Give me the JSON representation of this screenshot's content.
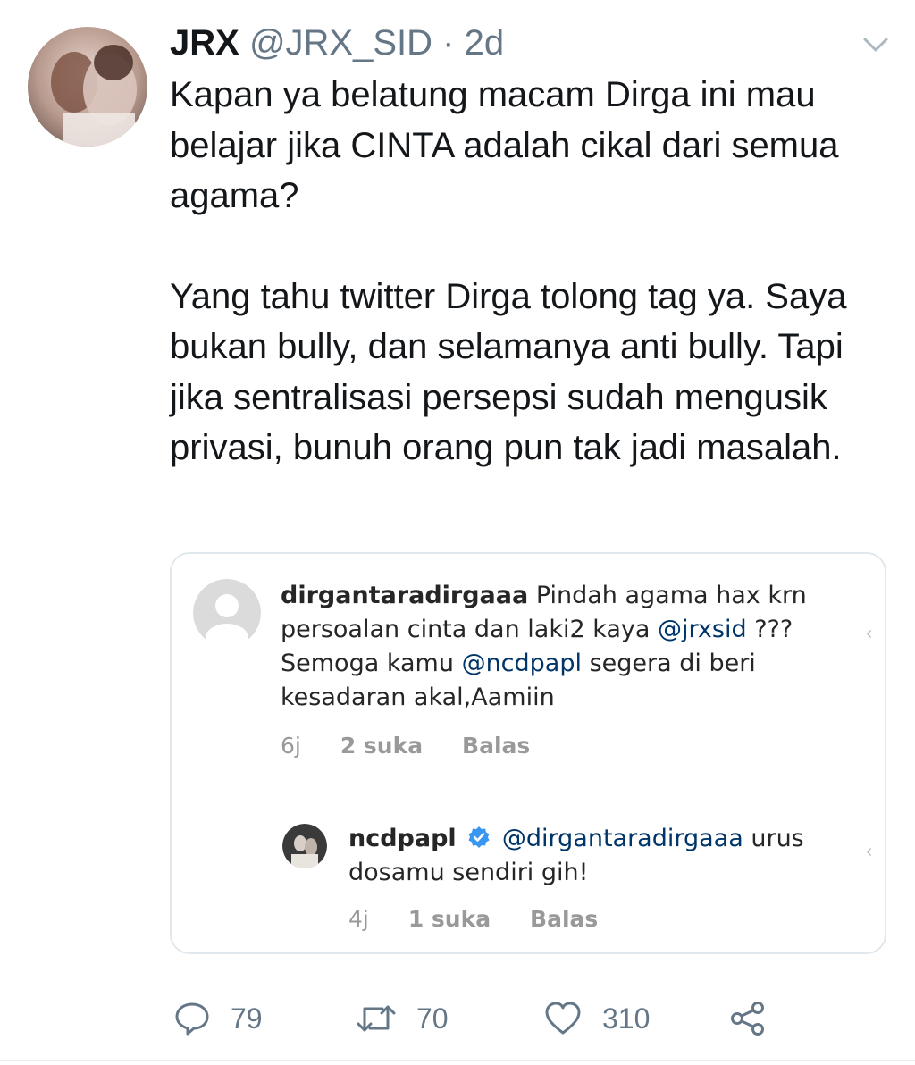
{
  "tweet": {
    "display_name": "JRX",
    "handle": "@JRX_SID",
    "separator": "·",
    "time": "2d",
    "text_p1": "Kapan ya belatung macam Dirga ini mau belajar jika CINTA adalah cikal dari semua agama?",
    "text_p2": "Yang tahu twitter Dirga tolong tag ya. Saya bukan bully, dan selamanya anti bully. Tapi jika sentralisasi persepsi sudah mengusik privasi, bunuh orang pun tak jadi masalah."
  },
  "embedded_screenshot": {
    "comment1": {
      "username": "dirgantaradirgaaa",
      "text_a": "Pindah agama hax krn persoalan cinta dan laki2 kaya",
      "mention1": "@jrxsid",
      "text_b": "??? Semoga kamu",
      "mention2": "@ncdpapl",
      "text_c": "segera di beri kesadaran akal,Aamiin",
      "age": "6j",
      "likes": "2 suka",
      "reply_label": "Balas"
    },
    "comment2": {
      "username": "ncdpapl",
      "mention": "@dirgantaradirgaaa",
      "text": "urus dosamu sendiri gih!",
      "age": "4j",
      "likes": "1 suka",
      "reply_label": "Balas"
    }
  },
  "actions": {
    "replies": "79",
    "retweets": "70",
    "likes": "310"
  },
  "icons": {
    "reply": "reply-icon",
    "retweet": "retweet-icon",
    "like": "heart-icon",
    "share": "share-icon",
    "menu": "chevron-down-icon",
    "verified": "verified-badge-icon"
  },
  "colors": {
    "text": "#14171a",
    "secondary": "#657786",
    "instagram_link": "#003569",
    "verified": "#3897f0"
  }
}
